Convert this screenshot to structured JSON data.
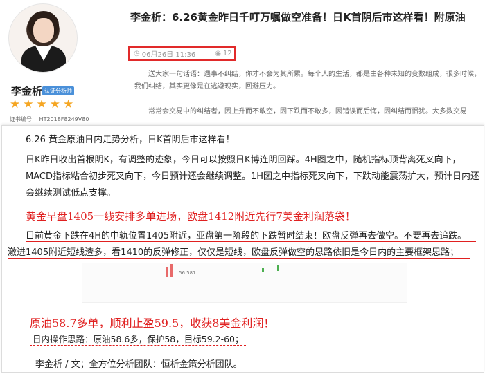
{
  "header": {
    "author_name": "李金析",
    "cert_badge": "认证分析师",
    "stars": [
      "★",
      "★",
      "★",
      "★",
      "★"
    ],
    "cert_label": "证书编号",
    "cert_number": "HT2018F8249V80",
    "title": "李金析：6.26黄金昨日千叮万嘱做空准备！日K首阴后市这样看！附原油",
    "date": "06月26日 11:36",
    "views": "12",
    "preview_para_1": "送大家一句话语：遇事不纠结，你才不会为其所累。每个人的生活，都是由各种未知的变数组成，很多时候，我们纠结，其实更像是在逃避现实，回避压力。",
    "preview_para_2": "常常会交易中的纠结者，因上升而不敢空，因下跌而不敢多，因错误而后悔，因纠结而惯犹。大多数交易"
  },
  "article": {
    "subtitle": "6.26 黄金原油日内走势分析，日K首阴后市这样看！",
    "para_1": "日K昨日收出首根阴K，有调整的迹象，今日可以按照日K博连阴回踩。4H图之中，随机指标顶背离死叉向下，MACD指标粘合初步死叉向下，今日预计还会继续调整。1H图之中指标死叉向下，下跌动能震荡扩大，预计日内还会继续测试低点支撑。",
    "red_heading_1": "黄金早盘1405一线安排多单进场，欧盘1412附近先行7美金利润落袋！",
    "line_1": "目前黄金下跌在4H的中轨位置1405附近，亚盘第一阶段的下跌暂时结束！欧盘反弹再去做空。不要再去追跌。",
    "line_2": "激进1405附近短线渣多，看1410的反弹修正，仅仅是短线，欧盘反弹做空的思路依旧是今日内的主要框架思路；",
    "chart_label": "56.581",
    "red_heading_2": "原油58.7多单，顺利止盈59.5，收获8美金利润！",
    "op_plan": "日内操作思路：原油58.6多，保护58，目标59.2-60；",
    "footer": "李金析 / 文；全方位分析团队：恒析金策分析团队。"
  },
  "icons": {
    "clock": "clock-icon",
    "eye": "eye-icon",
    "star": "star-icon"
  },
  "colors": {
    "accent_red": "#e02020",
    "star": "#f5a623",
    "badge_blue": "#4a90d9"
  }
}
